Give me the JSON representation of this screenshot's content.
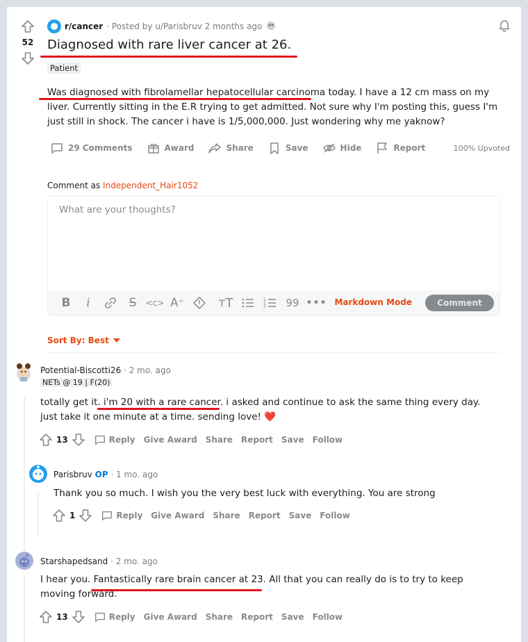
{
  "post": {
    "votes": "52",
    "subreddit": "r/cancer",
    "posted_by": "· Posted by u/Parisbruv 2 months ago",
    "title": "Diagnosed with rare liver cancer at 26.",
    "flair": "Patient",
    "body_underlined": "Was diagnosed with fibrolamellar hepatocellular carcinoma",
    "body_rest": " today. I have a 12 cm mass on my liver. Currently sitting in the E.R trying to get admitted. Not sure why I'm posting this, guess I'm just still in shock. The cancer i have is 1/5,000,000. Just wondering why me yaknow?",
    "upvoted": "100% Upvoted"
  },
  "actions": {
    "comments": "29 Comments",
    "award": "Award",
    "share": "Share",
    "save": "Save",
    "hide": "Hide",
    "report": "Report"
  },
  "comment_box": {
    "label": "Comment as",
    "username": "Independent_Hair1052",
    "placeholder": "What are your thoughts?",
    "markdown_mode": "Markdown Mode",
    "submit": "Comment"
  },
  "sort": {
    "label": "Sort By: Best"
  },
  "comments": [
    {
      "author": "Potential-Biscotti26",
      "time": " · 2 mo. ago",
      "flair": "NETs @ 19 | F(20)",
      "text_a": "totally get it. ",
      "text_underlined": "i'm 20 with a rare cancer.",
      "text_b": " i asked and continue to ask the same thing every day. just take it one minute at a time. sending love! ❤️",
      "score": "13"
    },
    {
      "author": "Parisbruv",
      "op": "OP",
      "time": " · 1 mo. ago",
      "text": "Thank you so much. I wish you the very best luck with everything. You are strong",
      "score": "1"
    },
    {
      "author": "Starshapedsand",
      "time": " · 2 mo. ago",
      "text_a": "I hear you. ",
      "text_underlined": "Fantastically rare brain cancer at 23.",
      "text_b": " All that you can really do is to try to keep moving forward.",
      "score": "13"
    }
  ],
  "comment_actions": {
    "reply": "Reply",
    "give_award": "Give Award",
    "share": "Share",
    "report": "Report",
    "save": "Save",
    "follow": "Follow"
  },
  "colors": {
    "accent": "#e84a12",
    "underline": "#e0141e",
    "op_blue": "#0079d3"
  }
}
